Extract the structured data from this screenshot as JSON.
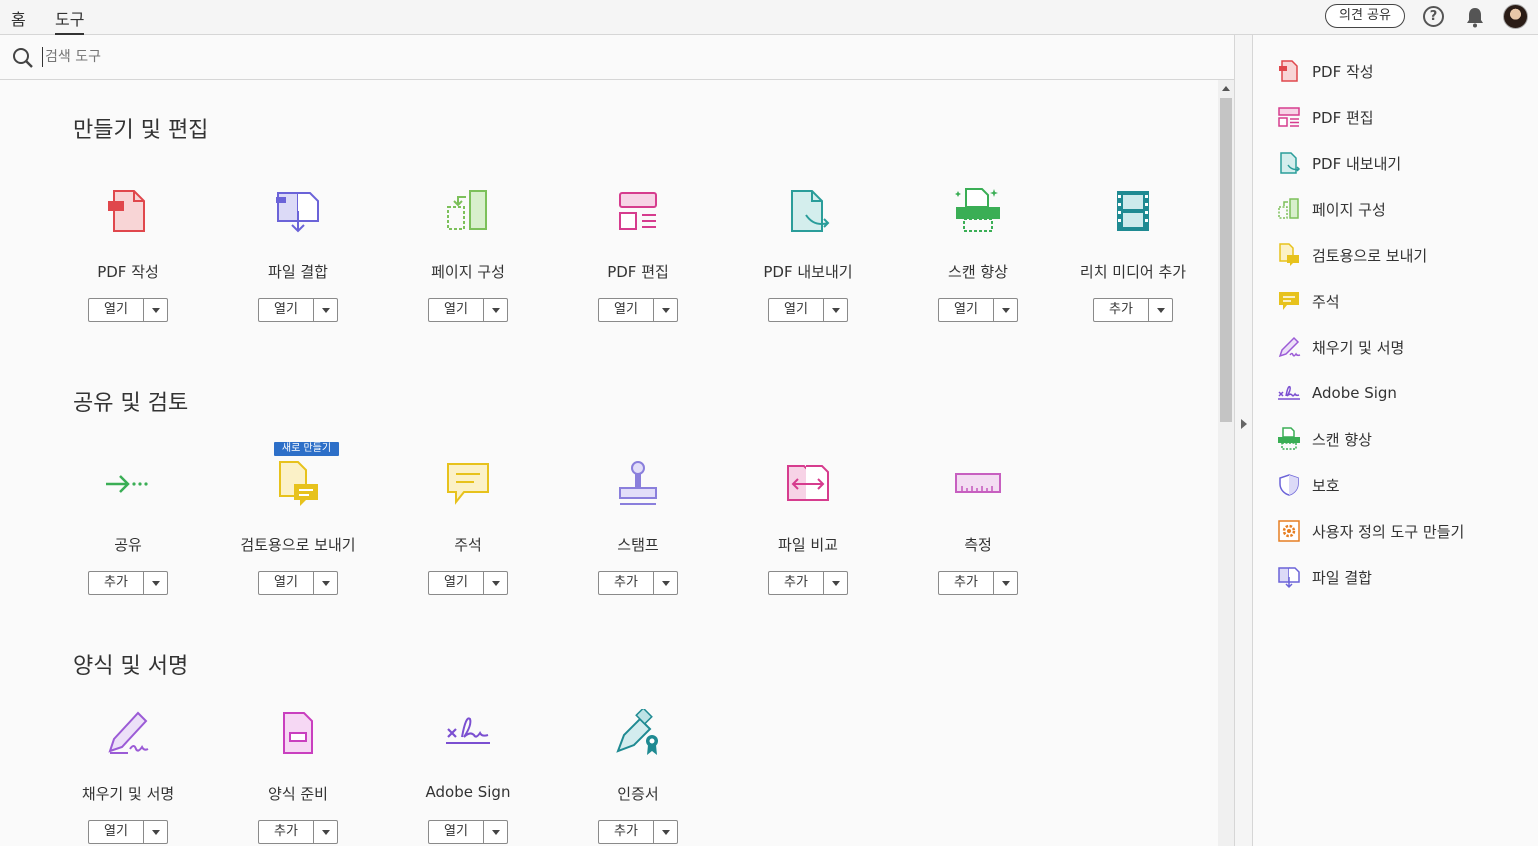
{
  "top_tabs": {
    "home": "홈",
    "tools": "도구"
  },
  "top_actions": {
    "share": "의견 공유",
    "help": "?"
  },
  "search": {
    "placeholder": "검색 도구"
  },
  "sections": {
    "create_edit": "만들기 및 편집",
    "share_review": "공유 및 검토",
    "forms_sign": "양식 및 서명"
  },
  "tools": {
    "create_pdf": {
      "label": "PDF 작성",
      "action": "열기"
    },
    "combine": {
      "label": "파일 결합",
      "action": "열기"
    },
    "organize": {
      "label": "페이지 구성",
      "action": "열기"
    },
    "edit_pdf": {
      "label": "PDF 편집",
      "action": "열기"
    },
    "export_pdf": {
      "label": "PDF 내보내기",
      "action": "열기"
    },
    "scan": {
      "label": "스캔 향상",
      "action": "열기"
    },
    "rich_media": {
      "label": "리치 미디어 추가",
      "action": "추가"
    },
    "share": {
      "label": "공유",
      "action": "추가"
    },
    "send_review": {
      "label": "검토용으로 보내기",
      "action": "열기",
      "badge": "새로 만들기"
    },
    "comment": {
      "label": "주석",
      "action": "열기"
    },
    "stamp": {
      "label": "스탬프",
      "action": "추가"
    },
    "compare": {
      "label": "파일 비교",
      "action": "추가"
    },
    "measure": {
      "label": "측정",
      "action": "추가"
    },
    "fill_sign": {
      "label": "채우기 및 서명",
      "action": "열기"
    },
    "prepare_form": {
      "label": "양식 준비",
      "action": "추가"
    },
    "adobe_sign": {
      "label": "Adobe Sign",
      "action": "열기"
    },
    "certificates": {
      "label": "인증서",
      "action": "추가"
    }
  },
  "right_pane": [
    {
      "label": "PDF 작성",
      "icon": "create-pdf-icon"
    },
    {
      "label": "PDF 편집",
      "icon": "edit-pdf-icon"
    },
    {
      "label": "PDF 내보내기",
      "icon": "export-pdf-icon"
    },
    {
      "label": "페이지 구성",
      "icon": "organize-pages-icon"
    },
    {
      "label": "검토용으로 보내기",
      "icon": "send-review-icon"
    },
    {
      "label": "주석",
      "icon": "comment-icon"
    },
    {
      "label": "채우기 및 서명",
      "icon": "fill-sign-icon"
    },
    {
      "label": "Adobe Sign",
      "icon": "adobe-sign-icon"
    },
    {
      "label": "스캔 향상",
      "icon": "scan-icon"
    },
    {
      "label": "보호",
      "icon": "protect-icon"
    },
    {
      "label": "사용자 정의 도구 만들기",
      "icon": "custom-tool-icon"
    },
    {
      "label": "파일 결합",
      "icon": "combine-files-icon"
    }
  ],
  "colors": {
    "create_pdf": "#e0474c",
    "combine": "#6b63d8",
    "organize": "#7cc05a",
    "edit_pdf": "#d63c8e",
    "export_pdf": "#2a9d9a",
    "scan": "#3aae55",
    "rich_media": "#1f8a92",
    "share": "#3aae55",
    "review": "#e7c21c",
    "stamp": "#8a7fdc",
    "compare": "#d63c8e",
    "measure": "#c75fc0",
    "fill_sign": "#9b5bd6",
    "adobe_sign": "#7b4fd1",
    "certificates": "#1f8a92",
    "protect": "#6b63d8",
    "custom": "#e67e22"
  }
}
